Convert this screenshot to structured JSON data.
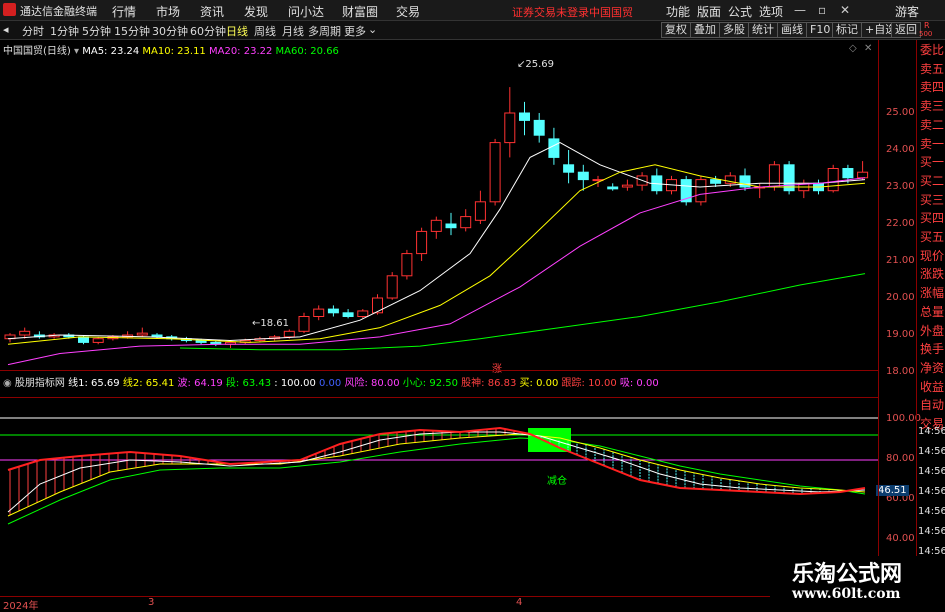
{
  "menubar": {
    "app_title": "通达信金融终端",
    "items": [
      "行情",
      "市场",
      "资讯",
      "发现",
      "问小达",
      "财富圈",
      "交易"
    ],
    "notice": "证券交易未登录",
    "stock_tag": "中国国贸",
    "right_items": [
      "功能",
      "版面",
      "公式",
      "选项"
    ],
    "user": "游客"
  },
  "toolbar": {
    "periods": [
      "分时",
      "1分钟",
      "5分钟",
      "15分钟",
      "30分钟",
      "60分钟",
      "日线",
      "周线",
      "月线",
      "多周期",
      "更多"
    ],
    "active": "日线",
    "right_buttons": [
      "复权",
      "叠加",
      "多股",
      "统计",
      "画线",
      "F10",
      "标记",
      "+自选",
      "返回"
    ]
  },
  "main_legend": {
    "stock": "中国国贸(日线)",
    "ma5": "MA5: 23.24",
    "ma10": "MA10: 23.11",
    "ma20": "MA20: 23.22",
    "ma60": "MA60: 20.66",
    "colors": {
      "ma5": "#ffffff",
      "ma10": "#ffff00",
      "ma20": "#ff40ff",
      "ma60": "#00ff00"
    }
  },
  "annotations": {
    "high": "25.69",
    "low": "18.61",
    "marker": "涨",
    "signal": "减仓"
  },
  "price_axis": [
    "25.00",
    "24.00",
    "23.00",
    "22.00",
    "21.00",
    "20.00",
    "19.00",
    "18.00"
  ],
  "indicator_legend": {
    "name": "股朋指标网",
    "items": [
      {
        "text": "线1: 65.69",
        "color": "#ffffff"
      },
      {
        "text": "线2: 65.41",
        "color": "#ffff00"
      },
      {
        "text": "波: 64.19",
        "color": "#ff40ff"
      },
      {
        "text": "段: 63.43",
        "color": "#00ff00"
      },
      {
        "text": ": 100.00",
        "color": "#ffffff"
      },
      {
        "text": "0.00",
        "color": "#4060ff"
      },
      {
        "text": "风险: 80.00",
        "color": "#ff40ff"
      },
      {
        "text": "小心: 92.50",
        "color": "#00ff00"
      },
      {
        "text": "股神: 86.83",
        "color": "#ff4040"
      },
      {
        "text": "买: 0.00",
        "color": "#ffff00"
      },
      {
        "text": "跟踪: 10.00",
        "color": "#ff4040"
      },
      {
        "text": "吸: 0.00",
        "color": "#ff40ff"
      }
    ]
  },
  "ind_axis": [
    "100.00",
    "80.00",
    "60.00",
    "40.00"
  ],
  "ind_current": "46.51",
  "right_panel": [
    "委比",
    "卖五",
    "卖四",
    "卖三",
    "卖二",
    "卖一",
    "买一",
    "买二",
    "买三",
    "买四",
    "买五",
    "现价",
    "涨跌",
    "涨幅",
    "总量",
    "外盘",
    "换手",
    "净资",
    "收益",
    "自动",
    "交易"
  ],
  "right_times": [
    "14:56",
    "14:56",
    "14:56",
    "14:56",
    "14:56",
    "14:56",
    "14:56"
  ],
  "right_top": {
    "r": "R",
    "num": "500"
  },
  "date_axis": [
    "2024年",
    "3",
    "4"
  ],
  "watermark": {
    "title": "乐淘公式网",
    "url": "www.60lt.com"
  }
}
